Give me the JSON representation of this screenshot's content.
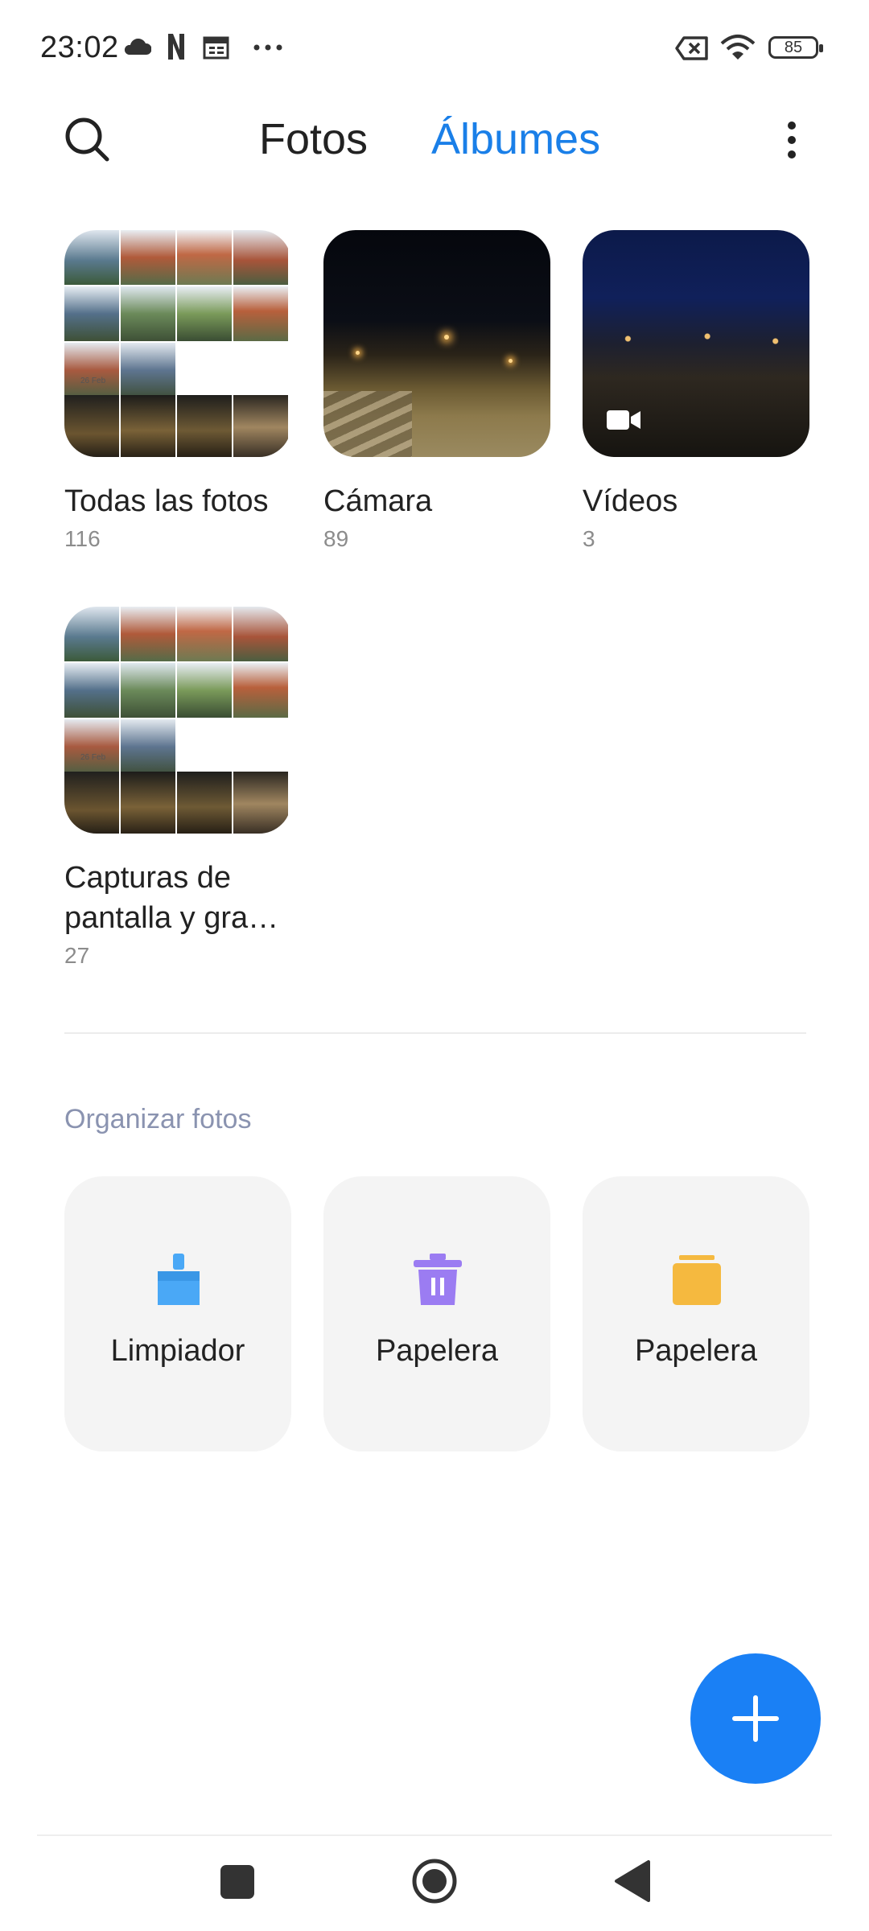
{
  "status_bar": {
    "time": "23:02",
    "battery": "85"
  },
  "header": {
    "tab_fotos": "Fotos",
    "tab_albumes": "Álbumes"
  },
  "albums": [
    {
      "name": "Todas las fotos",
      "count": "116",
      "date_label": "26 Feb"
    },
    {
      "name": "Cámara",
      "count": "89"
    },
    {
      "name": "Vídeos",
      "count": "3"
    },
    {
      "name_line1": "Capturas de",
      "name_line2": "pantalla y gra…",
      "count": "27",
      "date_label": "26 Feb"
    }
  ],
  "organize": {
    "title": "Organizar fotos",
    "items": [
      {
        "label": "Limpiador",
        "icon": "cleaner-brush-icon",
        "color": "#4aa8f6"
      },
      {
        "label": "Papelera",
        "icon": "trash-icon",
        "color": "#9b7cf2"
      },
      {
        "label": "Papelera",
        "icon": "folder-icon",
        "color": "#f5b93f"
      }
    ]
  },
  "colors": {
    "accent": "#1a7fe8",
    "fab": "#1a80f5"
  }
}
